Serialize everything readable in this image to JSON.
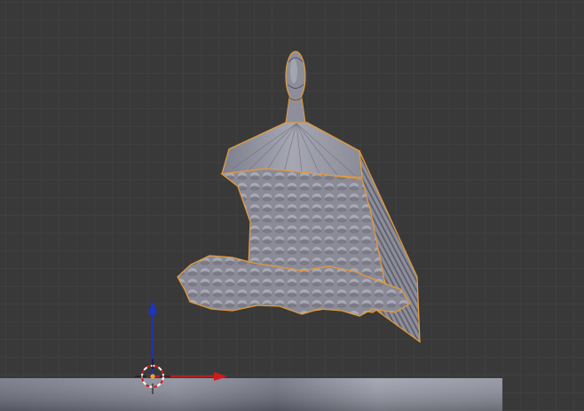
{
  "viewport": {
    "background": "#393939",
    "grid_color": "#444444"
  },
  "scene": {
    "object_selected": true,
    "selection_outline_color": "#e39b3c",
    "mesh_color": "#8a8b9b",
    "ground_plane_color": "#7d8090"
  },
  "gizmo": {
    "x_axis_color": "#d11a1a",
    "z_axis_color": "#1a33cc",
    "cursor_icon": "3d-cursor-icon"
  }
}
